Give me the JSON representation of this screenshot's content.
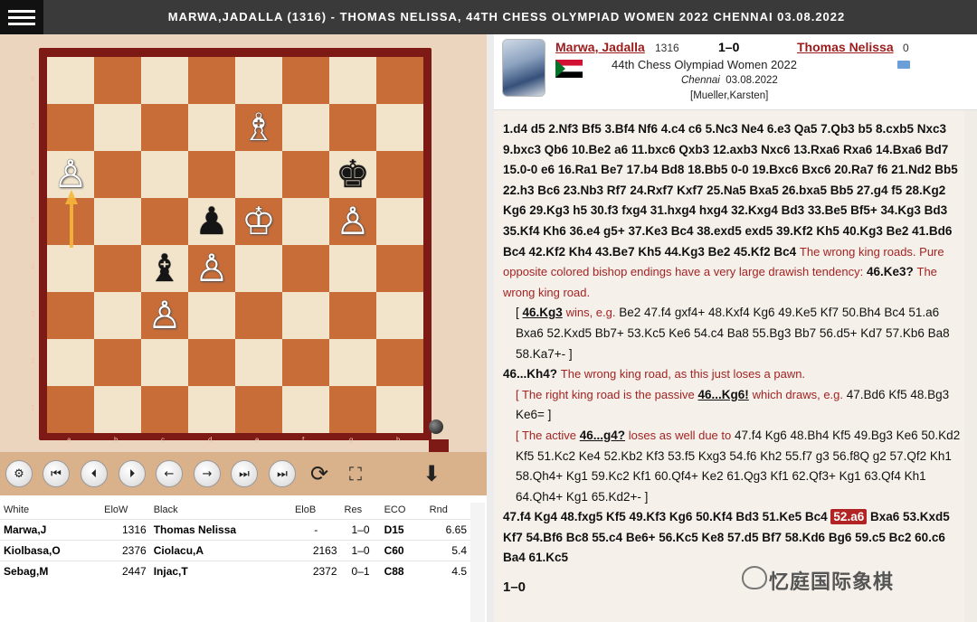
{
  "title": "MARWA,JADALLA (1316) - THOMAS NELISSA, 44TH CHESS OLYMPIAD WOMEN 2022 CHENNAI 03.08.2022",
  "board": {
    "ranks": [
      "8",
      "7",
      "6",
      "5",
      "4",
      "3",
      "2",
      "1"
    ],
    "files": [
      "a",
      "b",
      "c",
      "d",
      "e",
      "f",
      "g",
      "h"
    ],
    "position": [
      [
        "",
        "",
        "",
        "",
        "",
        "",
        "",
        ""
      ],
      [
        "",
        "",
        "",
        "",
        "B",
        "",
        "",
        ""
      ],
      [
        "P",
        "",
        "",
        "",
        "",
        "",
        "k",
        ""
      ],
      [
        "",
        "",
        "",
        "p",
        "K",
        "",
        "P",
        ""
      ],
      [
        "",
        "",
        "b",
        "P",
        "",
        "",
        "",
        ""
      ],
      [
        "",
        "",
        "P",
        "",
        "",
        "",
        "",
        ""
      ],
      [
        "",
        "",
        "",
        "",
        "",
        "",
        "",
        ""
      ],
      [
        "",
        "",
        "",
        "",
        "",
        "",
        "",
        ""
      ]
    ],
    "last_move_arrow": "a5-a6"
  },
  "controls": {
    "buttons": [
      "settings",
      "first",
      "previous",
      "next",
      "back",
      "forward",
      "last",
      "end",
      "flip",
      "fullscreen",
      "download"
    ]
  },
  "games_table": {
    "headers": [
      "White",
      "EloW",
      "Black",
      "EloB",
      "Res",
      "ECO",
      "Rnd"
    ],
    "rows": [
      {
        "white": "Marwa,J",
        "elow": "1316",
        "black": "Thomas Nelissa",
        "elob": "-",
        "res": "1–0",
        "eco": "D15",
        "rnd": "6.65"
      },
      {
        "white": "Kiolbasa,O",
        "elow": "2376",
        "black": "Ciolacu,A",
        "elob": "2163",
        "res": "1–0",
        "eco": "C60",
        "rnd": "5.4"
      },
      {
        "white": "Sebag,M",
        "elow": "2447",
        "black": "Injac,T",
        "elob": "2372",
        "res": "0–1",
        "eco": "C88",
        "rnd": "4.5"
      }
    ]
  },
  "game_info": {
    "white_name": "Marwa, Jadalla",
    "white_elo": "1316",
    "result": "1–0",
    "black_name": "Thomas Nelissa",
    "black_elo": "0",
    "event": "44th Chess Olympiad Women 2022",
    "site": "Chennai",
    "date": "03.08.2022",
    "annotator": "[Mueller,Karsten]"
  },
  "notation": {
    "main1": "1.d4 d5 2.Nf3 Bf5 3.Bf4 Nf6 4.c4 c6 5.Nc3 Ne4 6.e3 Qa5 7.Qb3 b5 8.cxb5 Nxc3 9.bxc3 Qb6 10.Be2 a6 11.bxc6 Qxb3 12.axb3 Nxc6 13.Rxa6 Rxa6 14.Bxa6 Bd7 15.0-0 e6 16.Ra1 Be7 17.b4 Bd8 18.Bb5 0-0 19.Bxc6 Bxc6 20.Ra7 f6 21.Nd2 Bb5 22.h3 Bc6 23.Nb3 Rf7 24.Rxf7 Kxf7 25.Na5 Bxa5 26.bxa5 Bb5 27.g4 f5 28.Kg2 Kg6 29.Kg3 h5 30.f3 fxg4 31.hxg4 hxg4 32.Kxg4 Bd3 33.Be5 Bf5+ 34.Kg3 Bd3 35.Kf4 Kh6 36.e4 g5+ 37.Ke3 Bc4 38.exd5 exd5 39.Kf2 Kh5 40.Kg3 Be2 41.Bd6 Bc4 42.Kf2 Kh4 43.Be7 Kh5 44.Kg3 Be2 45.Kf2 Bc4",
    "comment1": "The wrong king roads. Pure opposite colored bishop endings have a very large drawish tendency:",
    "move46": "46.Ke3?",
    "comment2": "The wrong king road.",
    "var1_open": "[",
    "var1_key": "46.Kg3",
    "var1_comment": "wins, e.g.",
    "var1_moves": "Be2 47.f4 gxf4+ 48.Kxf4 Kg6 49.Ke5 Kf7 50.Bh4 Bc4 51.a6 Bxa6 52.Kxd5 Bb7+ 53.Kc5 Ke6 54.c4 Ba8 55.Bg3 Bb7 56.d5+ Kd7 57.Kb6 Ba8 58.Ka7+- ]",
    "move46b": "46...Kh4?",
    "comment3": "The wrong king road, as this just loses a pawn.",
    "var2_open": "[ The right king road is the passive",
    "var2_key": "46...Kg6!",
    "var2_comment": "which draws, e.g.",
    "var2_moves": "47.Bd6 Kf5 48.Bg3 Ke6= ]",
    "var3_open": "[ The active",
    "var3_key": "46...g4?",
    "var3_comment": "loses as well due to",
    "var3_moves": "47.f4 Kg6 48.Bh4 Kf5 49.Bg3 Ke6 50.Kd2 Kf5 51.Kc2 Ke4 52.Kb2 Kf3 53.f5 Kxg3 54.f6 Kh2 55.f7 g3 56.f8Q g2 57.Qf2 Kh1 58.Qh4+ Kg1 59.Kc2 Kf1 60.Qf4+ Ke2 61.Qg3 Kf1 62.Qf3+ Kg1 63.Qf4 Kh1 64.Qh4+ Kg1 65.Kd2+- ]",
    "main2a": "47.f4 Kg4 48.fxg5 Kf5 49.Kf3 Kg6 50.Kf4 Bd3 51.Ke5 Bc4",
    "current": "52.a6",
    "main2b": "Bxa6 53.Kxd5 Kf7 54.Bf6 Bc8 55.c4 Be6+ 56.Kc5 Ke8 57.d5 Bf7 58.Kd6 Bg6 59.c5 Bc2 60.c6 Ba4 61.Kc5",
    "final": "1–0"
  },
  "watermark": "忆庭国际象棋",
  "colors": {
    "light_square": "#f1e4cb",
    "dark_square": "#c96d38",
    "frame": "#7d1a16",
    "accent": "#9b1b1b"
  }
}
